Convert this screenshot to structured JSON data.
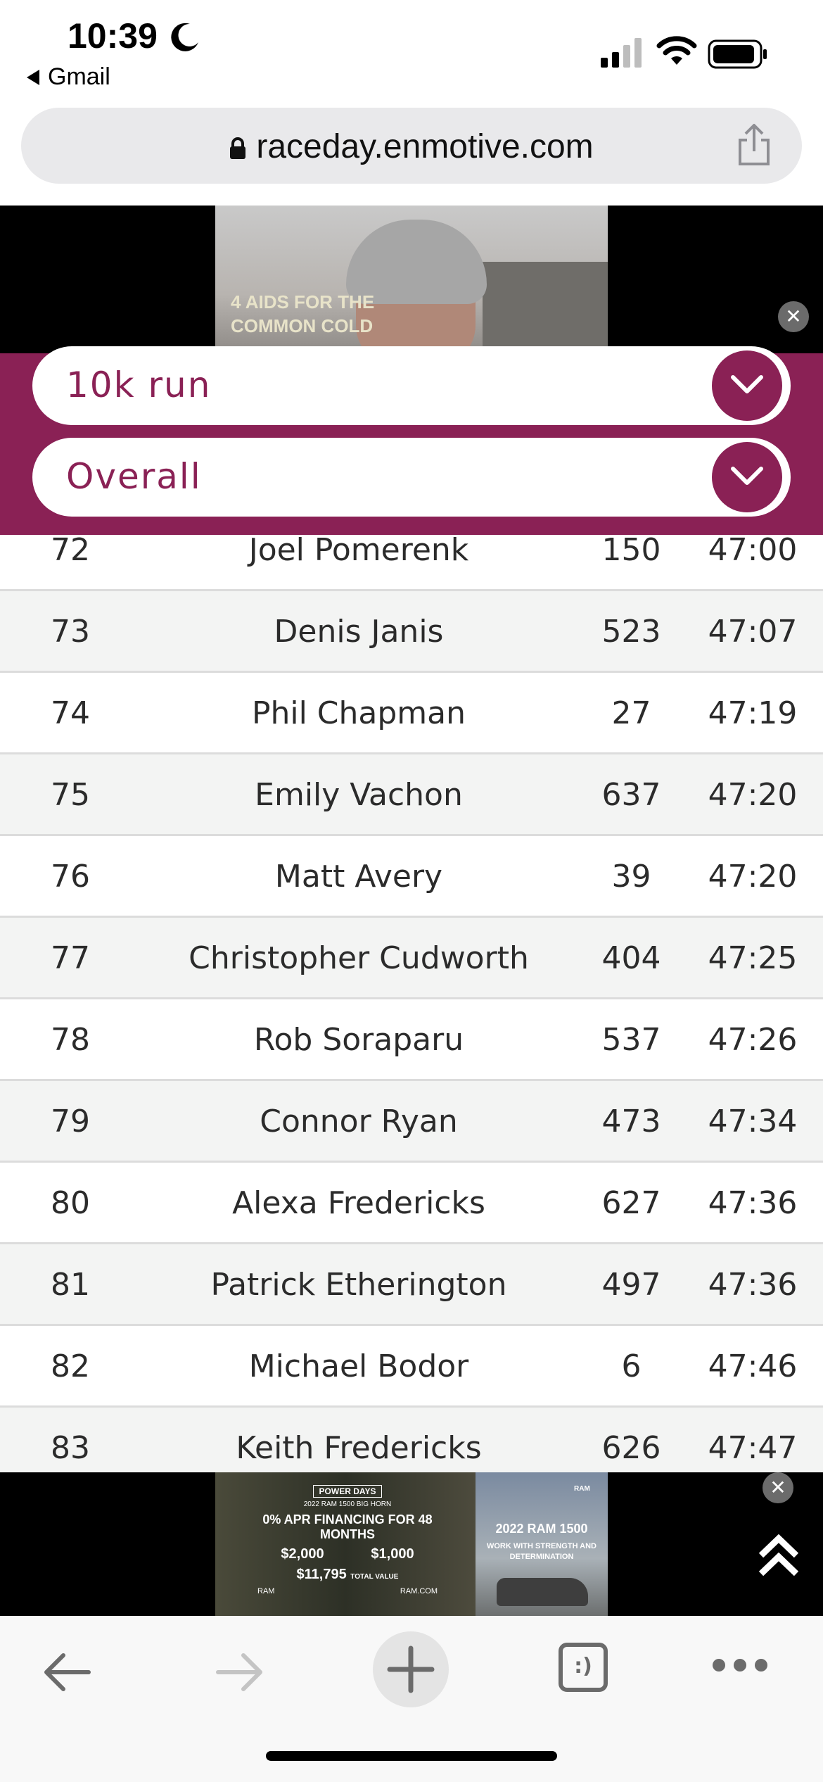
{
  "status_bar": {
    "time": "10:39",
    "back_app": "Gmail",
    "icons": [
      "moon-icon",
      "cellular-signal-icon",
      "wifi-icon",
      "battery-icon"
    ]
  },
  "browser": {
    "url": "raceday.enmotive.com",
    "icons": [
      "lock-icon",
      "share-icon"
    ]
  },
  "ad_top": {
    "text_line1": "4 AIDS FOR THE",
    "text_line2": "COMMON COLD"
  },
  "filters": {
    "race": "10k run",
    "category": "Overall"
  },
  "results": [
    {
      "place": "72",
      "name": "Joel Pomerenk",
      "bib": "150",
      "time": "47:00"
    },
    {
      "place": "73",
      "name": "Denis Janis",
      "bib": "523",
      "time": "47:07"
    },
    {
      "place": "74",
      "name": "Phil Chapman",
      "bib": "27",
      "time": "47:19"
    },
    {
      "place": "75",
      "name": "Emily Vachon",
      "bib": "637",
      "time": "47:20"
    },
    {
      "place": "76",
      "name": "Matt Avery",
      "bib": "39",
      "time": "47:20"
    },
    {
      "place": "77",
      "name": "Christopher Cudworth",
      "bib": "404",
      "time": "47:25"
    },
    {
      "place": "78",
      "name": "Rob Soraparu",
      "bib": "537",
      "time": "47:26"
    },
    {
      "place": "79",
      "name": "Connor Ryan",
      "bib": "473",
      "time": "47:34"
    },
    {
      "place": "80",
      "name": "Alexa Fredericks",
      "bib": "627",
      "time": "47:36"
    },
    {
      "place": "81",
      "name": "Patrick Etherington",
      "bib": "497",
      "time": "47:36"
    },
    {
      "place": "82",
      "name": "Michael Bodor",
      "bib": "6",
      "time": "47:46"
    },
    {
      "place": "83",
      "name": "Keith Fredericks",
      "bib": "626",
      "time": "47:47"
    }
  ],
  "ad_bottom": {
    "badge": "POWER DAYS",
    "model_line": "2022 RAM 1500 BIG HORN",
    "financing": "0% APR FINANCING FOR 48 MONTHS",
    "cash_1": "$2,000",
    "cash_2": "$1,000",
    "total": "$11,795",
    "total_label": "TOTAL VALUE",
    "brand": "RAM",
    "site": "RAM.COM",
    "headline": "2022 RAM 1500",
    "subline": "WORK WITH STRENGTH AND DETERMINATION"
  },
  "ad_close_symbol": "✕",
  "toolbar": {
    "icons": [
      "back-arrow-icon",
      "forward-arrow-icon",
      "new-tab-plus-icon",
      "tabs-icon",
      "more-icon"
    ],
    "tabs_label": ":)"
  },
  "colors": {
    "brand": "#8a2155",
    "row_alt": "#f3f4f3",
    "divider": "#dcdcdc"
  }
}
